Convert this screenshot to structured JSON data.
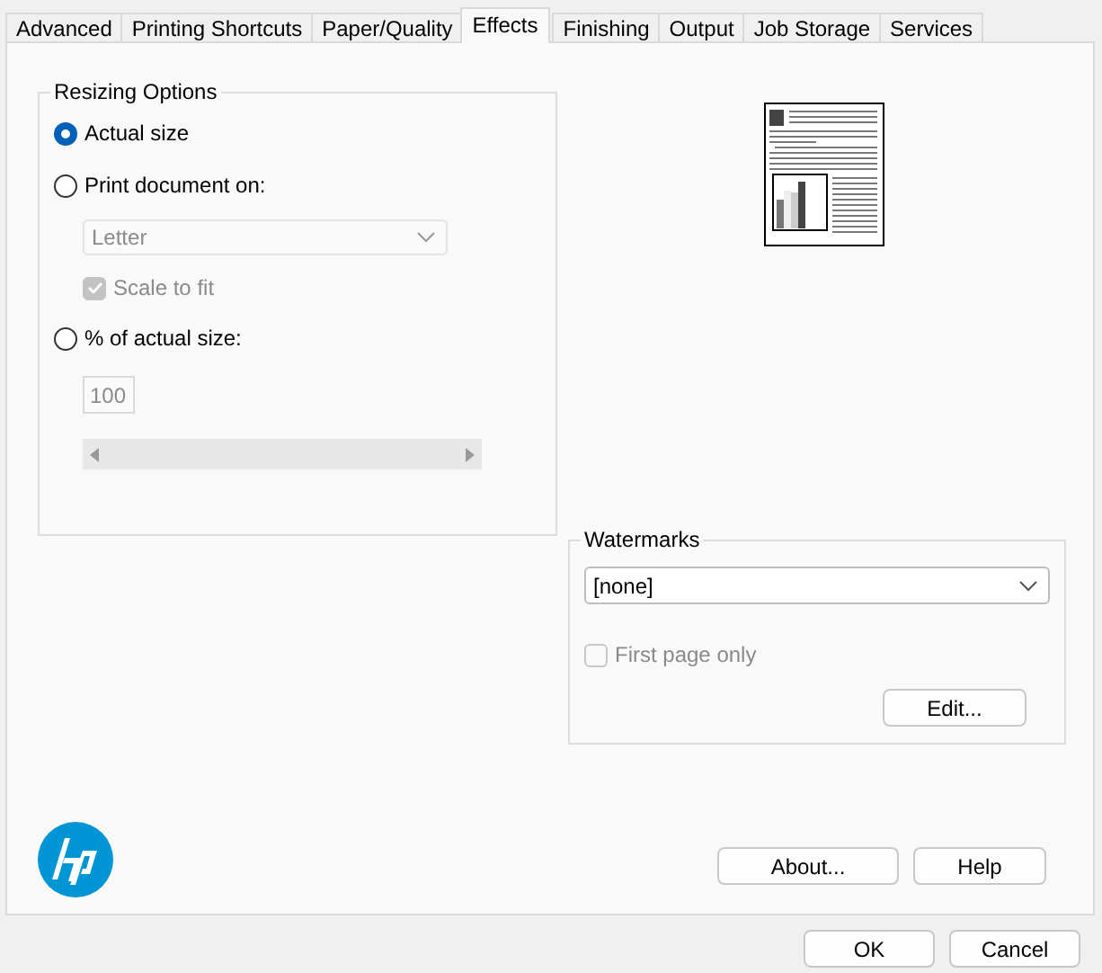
{
  "tabs": [
    {
      "label": "Advanced",
      "selected": false
    },
    {
      "label": "Printing Shortcuts",
      "selected": false
    },
    {
      "label": "Paper/Quality",
      "selected": false
    },
    {
      "label": "Effects",
      "selected": true
    },
    {
      "label": "Finishing",
      "selected": false
    },
    {
      "label": "Output",
      "selected": false
    },
    {
      "label": "Job Storage",
      "selected": false
    },
    {
      "label": "Services",
      "selected": false
    }
  ],
  "resizing_options": {
    "title": "Resizing Options",
    "options": [
      {
        "label": "Actual size",
        "selected": true
      },
      {
        "label": "Print document on:",
        "selected": false
      },
      {
        "label": "% of actual size:",
        "selected": false
      }
    ],
    "paper_size": {
      "value": "Letter",
      "disabled": true
    },
    "scale_to_fit": {
      "label": "Scale to fit",
      "checked": true,
      "disabled": true
    },
    "percent": {
      "value": "100",
      "disabled": true
    }
  },
  "watermarks": {
    "title": "Watermarks",
    "value": "[none]",
    "first_page_only": {
      "label": "First page only",
      "checked": false,
      "disabled": true
    },
    "edit_button": "Edit..."
  },
  "panel_buttons": [
    "About...",
    "Help"
  ],
  "dialog_buttons": [
    "OK",
    "Cancel"
  ]
}
